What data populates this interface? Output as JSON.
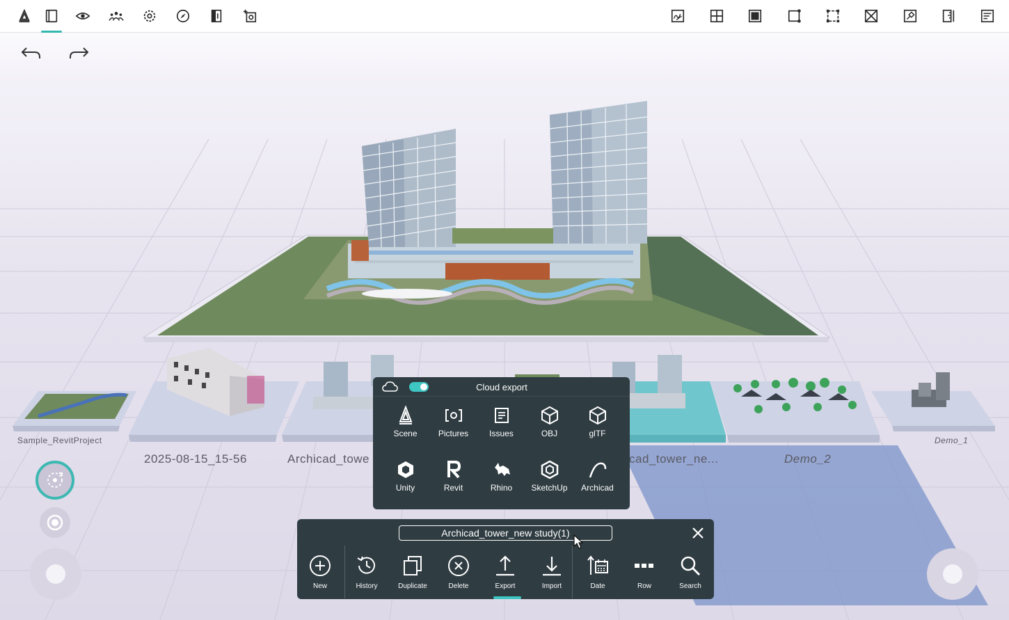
{
  "topbar": {
    "left_tools": [
      {
        "name": "scene-tool-icon"
      },
      {
        "name": "projects-tool-icon"
      },
      {
        "name": "visibility-tool-icon"
      },
      {
        "name": "collaboration-tool-icon"
      },
      {
        "name": "settings-tool-icon"
      },
      {
        "name": "navigation-compass-icon"
      },
      {
        "name": "section-tool-icon"
      },
      {
        "name": "capture-tool-icon"
      }
    ],
    "right_tools": [
      {
        "name": "sketch-tool-icon"
      },
      {
        "name": "grid-split-icon"
      },
      {
        "name": "frame-select-icon"
      },
      {
        "name": "edit-points-icon"
      },
      {
        "name": "bounding-box-icon"
      },
      {
        "name": "cross-box-icon"
      },
      {
        "name": "pin-tool-icon"
      },
      {
        "name": "measure-ruler-icon"
      },
      {
        "name": "properties-list-icon"
      }
    ]
  },
  "projects": [
    {
      "label": "Sample_RevitProject",
      "style": "small"
    },
    {
      "label": "2025-08-15_15-56",
      "style": "big"
    },
    {
      "label": "Archicad_towe",
      "style": "big"
    },
    {
      "label": "cad_tower_ne...",
      "style": "big"
    },
    {
      "label": "Demo_2",
      "style": "big-italic"
    },
    {
      "label": "Demo_1",
      "style": "small-italic"
    }
  ],
  "export_panel": {
    "title": "Cloud export",
    "cloud_toggle_on": true,
    "items": [
      {
        "label": "Scene",
        "icon": "scene-icon"
      },
      {
        "label": "Pictures",
        "icon": "pictures-icon"
      },
      {
        "label": "Issues",
        "icon": "issues-icon"
      },
      {
        "label": "OBJ",
        "icon": "obj-cube-icon"
      },
      {
        "label": "glTF",
        "icon": "gltf-cube-icon"
      },
      {
        "label": "Unity",
        "icon": "unity-icon"
      },
      {
        "label": "Revit",
        "icon": "revit-icon"
      },
      {
        "label": "Rhino",
        "icon": "rhino-icon"
      },
      {
        "label": "SketchUp",
        "icon": "sketchup-icon"
      },
      {
        "label": "Archicad",
        "icon": "archicad-icon"
      }
    ]
  },
  "project_bar": {
    "name_value": "Archicad_tower_new study(1)",
    "tools": [
      {
        "label": "New",
        "icon": "plus-circle-icon"
      },
      {
        "label": "History",
        "icon": "history-icon"
      },
      {
        "label": "Duplicate",
        "icon": "duplicate-icon"
      },
      {
        "label": "Delete",
        "icon": "delete-circle-icon"
      },
      {
        "label": "Export",
        "icon": "export-upload-icon"
      },
      {
        "label": "Import",
        "icon": "import-download-icon"
      },
      {
        "label": "Date",
        "icon": "sort-date-icon"
      },
      {
        "label": "Row",
        "icon": "row-dots-icon"
      },
      {
        "label": "Search",
        "icon": "search-icon"
      }
    ],
    "active_tool": "Export"
  },
  "colors": {
    "accent": "#3ec6c2",
    "panel_bg": "#2f3c42",
    "ground": "#6f8a5c"
  }
}
